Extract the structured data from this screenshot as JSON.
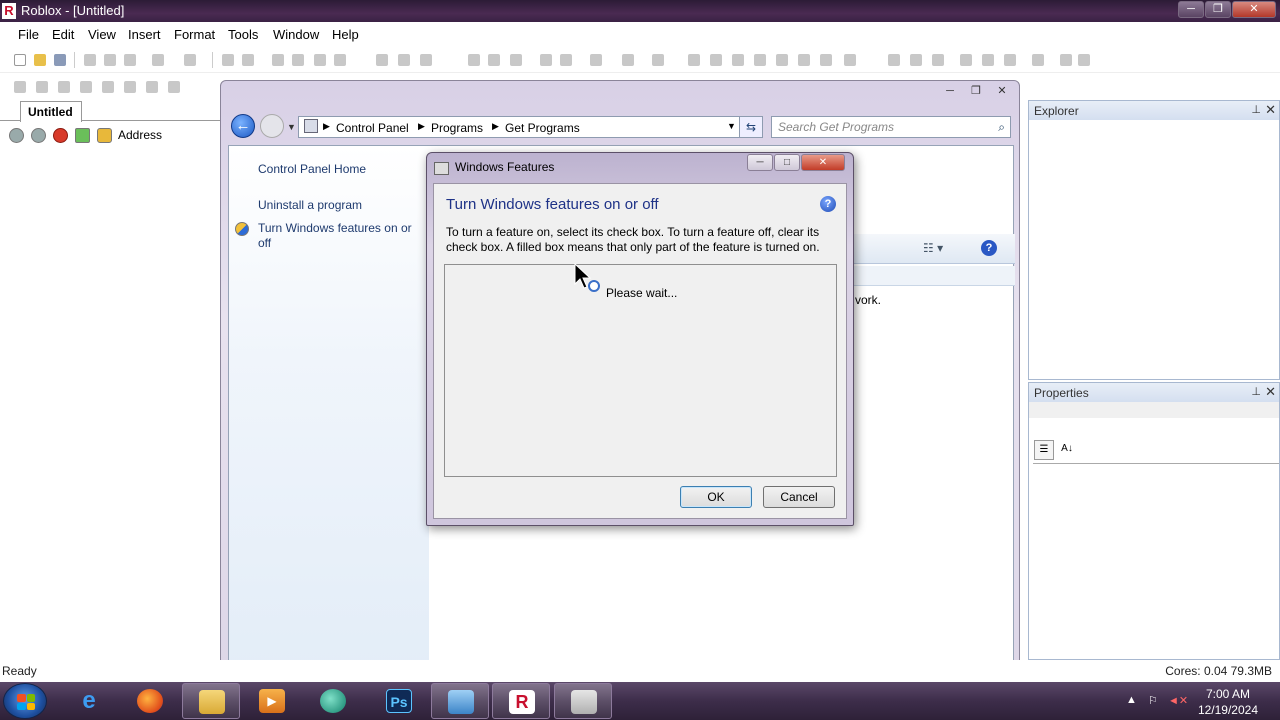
{
  "app": {
    "title": "Roblox - [Untitled]"
  },
  "menubar": {
    "items": [
      "File",
      "Edit",
      "View",
      "Insert",
      "Format",
      "Tools",
      "Window",
      "Help"
    ]
  },
  "doc_tab": {
    "label": "Untitled"
  },
  "nav": {
    "address_label": "Address"
  },
  "status": {
    "left": "Ready",
    "right": "Cores: 0.04   79.3MB"
  },
  "panels": {
    "explorer": "Explorer",
    "properties": "Properties"
  },
  "control_panel": {
    "breadcrumb": [
      "Control Panel",
      "Programs",
      "Get Programs"
    ],
    "search_placeholder": "Search Get Programs",
    "left_links": [
      "Control Panel Home",
      "Uninstall a program",
      "Turn Windows features on or off"
    ],
    "partial_text": "vork."
  },
  "dialog": {
    "title": "Windows Features",
    "heading": "Turn Windows features on or off",
    "description": "To turn a feature on, select its check box. To turn a feature off, clear its check box. A filled box means that only part of the feature is turned on.",
    "loading": "Please wait...",
    "ok": "OK",
    "cancel": "Cancel"
  },
  "taskbar": {
    "apps": [
      "internet-explorer-icon",
      "firefox-icon",
      "windows-explorer-icon",
      "media-player-icon",
      "app-icon",
      "photoshop-icon",
      "control-panel-icon",
      "roblox-studio-icon",
      "windows-features-icon"
    ],
    "time": "7:00 AM",
    "date": "12/19/2024"
  },
  "colors": {
    "accent": "#1e3287",
    "taskbar": "#3d2d4a",
    "titlebar": "#2c1b36"
  }
}
